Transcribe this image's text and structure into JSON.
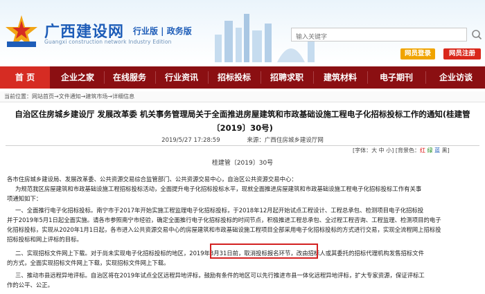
{
  "header": {
    "site_name": "广西建设网",
    "edition": "行业版 | 政务版",
    "site_name_en": "Guangxi construction network Industry Edition",
    "search": {
      "placeholder": "输入关键字"
    },
    "login_label": "网员登录",
    "register_label": "网员注册"
  },
  "nav": {
    "items": [
      {
        "label": "首 页"
      },
      {
        "label": "企业之家"
      },
      {
        "label": "在线服务"
      },
      {
        "label": "行业资讯"
      },
      {
        "label": "招标投标"
      },
      {
        "label": "招聘求职"
      },
      {
        "label": "建筑材料"
      },
      {
        "label": "电子期刊"
      },
      {
        "label": "企业访谈"
      }
    ]
  },
  "breadcrumb": {
    "prefix": "当前位置：",
    "path": "网站首页→文件通知→建筑市场→详细信息"
  },
  "article": {
    "title_line1": "自治区住房城乡建设厅 发展改革委 机关事务管理局关于全面推进房屋建筑和市政基础设施工程电子化招标投标工作的通知(桂建管",
    "title_line2": "〔2019〕30号)",
    "date": "2019/5/27 17:28:59",
    "source": "来源：广西住房城乡建设厅网",
    "font_label": "[字体：大 中 小]",
    "color_label": "[背景色：",
    "color_red": "红",
    "color_blue": "绿",
    "color_green": "蓝",
    "color_white": "黑]",
    "doc_number": "桂建管〔2019〕30号",
    "paragraphs": [
      "各市住房城乡建设局、发展改革委、公共资源交易综合监管部门、公共资源交易中心，自治区公共资源交易中心：",
      "为规范我区房屋建筑和市政基础设施工程招标投标活动，全面提升电子化招标投标水平，现就全面推进房屋建筑和市政基础设施工程电子化招标投标工作有关事",
      "项通知如下：",
      "一、全面推行电子化招标投标。南宁市于2017年开始实施工程监理电子化招标投标，于2018年12月起开始试点工程设计、工程总承包、检测项目电子化招标投",
      "并于2019年5月1日起全面实施。请各市参照南宁市经验，确定全面推行电子化招标投标的时间节点，积极推进工程总承包、全过程工程咨询、工程监理、检测项目的电子",
      "化招标投标，实现从2020年1月1日起，各市进入公共资源交易中心的房屋建筑和市政基础设施工程项目全部采用电子化招标投标的方式进行交易，实现全流程网上招标投",
      "招标投标和网上评标的目标。",
      "二、实现招标文件网上下载。对于尚未实现电子化招标投标的地区，2019年8月31日前，取消投标报名环节，改由招标人或其委托的招标代理机构发售招标文件",
      "的方式，全面实现招标文件网上下载，实现招标文件网上下载。",
      "三、推动市县远程异地评标。自治区将在2019年试点全区远程异地评标，鼓励有条件的地区可以先行推进市县一体化远程异地评标，扩大专家资源，保证评标工",
      "作的公平、公正。"
    ]
  },
  "colors": {
    "brand_blue": "#1e5db8",
    "nav_bg": "#8b0f12",
    "nav_active": "#d62c23",
    "login_btn": "#f0a400",
    "register_btn": "#d9271b",
    "highlight_box": "#d32020"
  },
  "icons": [
    "logo-star-icon",
    "search-icon",
    "skyline-illustration"
  ]
}
